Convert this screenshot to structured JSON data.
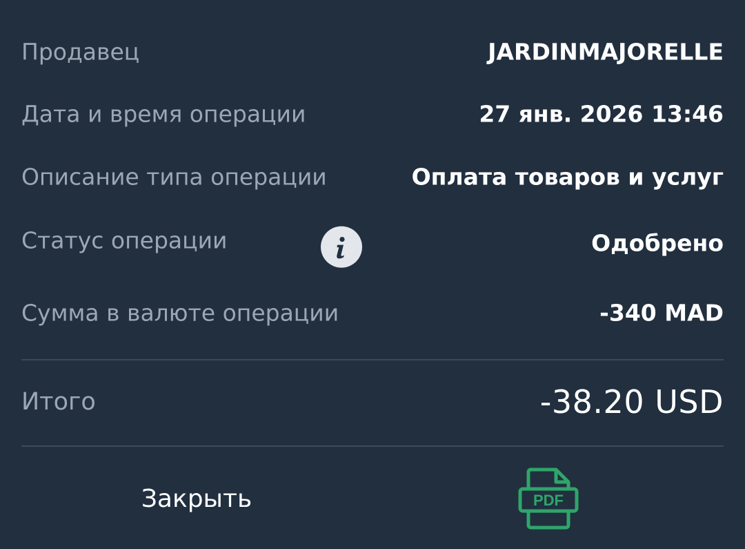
{
  "details": {
    "merchant": {
      "label": "Продавец",
      "value": "JARDINMAJORELLE"
    },
    "datetime": {
      "label": "Дата и время операции",
      "value": "27 янв. 2026 13:46"
    },
    "type": {
      "label": "Описание типа операции",
      "value": "Оплата товаров и услуг"
    },
    "status": {
      "label": "Статус операции",
      "value": "Одобрено"
    },
    "amount": {
      "label": "Сумма в валюте операции",
      "value": "-340 MAD"
    }
  },
  "total": {
    "label": "Итого",
    "value": "-38.20 USD"
  },
  "actions": {
    "close_label": "Закрыть",
    "pdf_label": "PDF"
  },
  "icons": {
    "info": "info-icon",
    "pdf": "pdf-file-icon"
  },
  "colors": {
    "background": "#212f3f",
    "label": "#9ca7b4",
    "value": "#ffffff",
    "pdf_accent": "#2fa56a"
  }
}
